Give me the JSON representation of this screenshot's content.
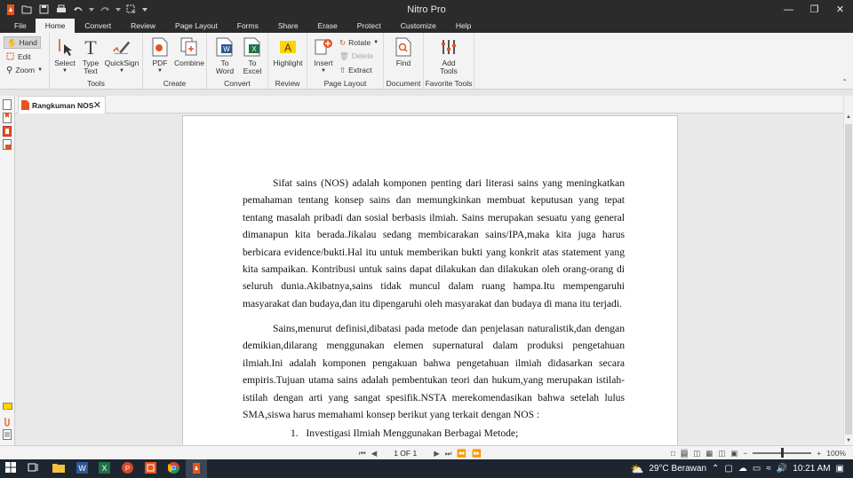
{
  "window": {
    "title": "Nitro Pro"
  },
  "tabs": [
    "File",
    "Home",
    "Convert",
    "Review",
    "Page Layout",
    "Forms",
    "Share",
    "Erase",
    "Protect",
    "Customize",
    "Help"
  ],
  "ribbon": {
    "nav": {
      "hand": "Hand",
      "edit": "Edit",
      "zoom": "Zoom"
    },
    "tools": {
      "select": "Select",
      "type_text": "Type Text",
      "quicksign": "QuickSign",
      "label": "Tools"
    },
    "create": {
      "pdf": "PDF",
      "combine": "Combine",
      "label": "Create"
    },
    "convert": {
      "to_word": "To Word",
      "to_excel": "To Excel",
      "label": "Convert"
    },
    "review": {
      "highlight": "Highlight",
      "label": "Review"
    },
    "page_layout": {
      "insert": "Insert",
      "rotate": "Rotate",
      "delete": "Delete",
      "extract": "Extract",
      "label": "Page Layout"
    },
    "document": {
      "find": "Find",
      "label": "Document"
    },
    "favorite": {
      "add_tools": "Add Tools",
      "label": "Favorite Tools"
    }
  },
  "doc_tab": {
    "title": "Rangkuman NOS"
  },
  "document": {
    "paragraph1": "Sifat sains (NOS) adalah komponen penting dari literasi sains yang meningkatkan pemahaman tentang konsep sains dan memungkinkan membuat keputusan yang tepat tentang masalah pribadi dan sosial berbasis ilmiah. Sains merupakan sesuatu yang general dimanapun kita berada.Jikalau sedang membicarakan sains/IPA,maka kita juga harus berbicara evidence/bukti.Hal itu untuk memberikan bukti yang konkrit atas statement yang kita sampaikan. Kontribusi untuk sains dapat dilakukan dan dilakukan oleh orang-orang di seluruh dunia.Akibatnya,sains tidak muncul dalam ruang hampa.Itu mempengaruhi masyarakat dan budaya,dan itu dipengaruhi oleh masyarakat dan budaya di mana itu terjadi.",
    "paragraph2": "Sains,menurut definisi,dibatasi pada metode dan penjelasan naturalistik,dan dengan demikian,dilarang menggunakan elemen supernatural dalam produksi pengetahuan ilmiah.Ini adalah komponen pengakuan bahwa pengetahuan ilmiah didasarkan secara empiris.Tujuan utama sains adalah pembentukan teori dan hukum,yang merupakan istilah-istilah dengan arti yang sangat spesifik.NSTA merekomendasikan bahwa setelah lulus SMA,siswa harus memahami konsep berikut yang terkait dengan NOS :",
    "list_item1_num": "1.",
    "list_item1": "Investigasi Ilmiah Menggunakan Berbagai Metode;"
  },
  "status": {
    "page": "1 OF 1",
    "zoom": "100%"
  },
  "taskbar": {
    "weather": "29°C  Berawan",
    "time": "10:21 AM"
  }
}
